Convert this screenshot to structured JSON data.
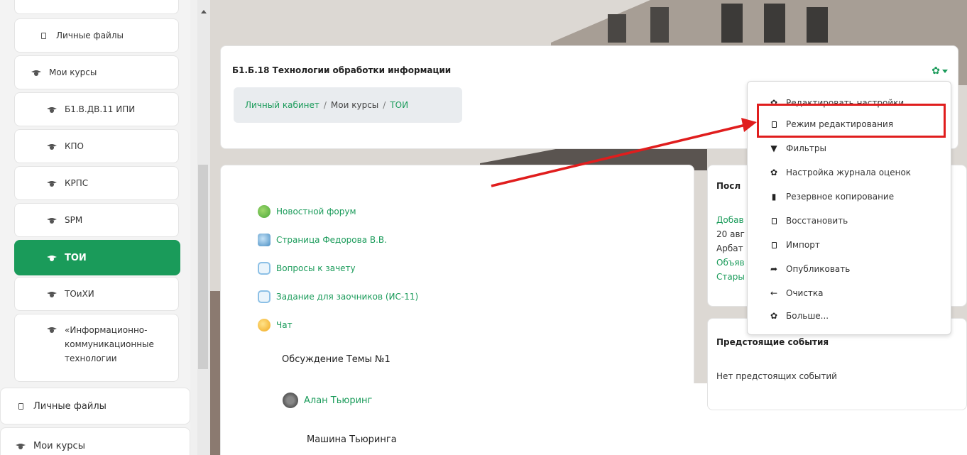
{
  "sidebar": {
    "items": [
      {
        "label": "Личные файлы",
        "icon": "file-icon"
      },
      {
        "label": "Мои курсы",
        "icon": "graduation-cap-icon"
      },
      {
        "label": "Б1.В.ДВ.11 ИПИ",
        "icon": "graduation-cap-icon"
      },
      {
        "label": "КПО",
        "icon": "graduation-cap-icon"
      },
      {
        "label": "КРПС",
        "icon": "graduation-cap-icon"
      },
      {
        "label": "SPM",
        "icon": "graduation-cap-icon"
      },
      {
        "label": "ТОИ",
        "icon": "graduation-cap-icon",
        "active": true
      },
      {
        "label": "ТОиХИ",
        "icon": "graduation-cap-icon"
      },
      {
        "label": "«Информационно-коммуникационные технологии",
        "icon": "graduation-cap-icon"
      },
      {
        "label": "Личные файлы",
        "icon": "file-icon"
      },
      {
        "label": "Мои курсы",
        "icon": "graduation-cap-icon"
      }
    ]
  },
  "header": {
    "course_title": "Б1.Б.18 Технологии обработки информации",
    "breadcrumb": [
      "Личный кабинет",
      "Мои курсы",
      "ТОИ"
    ],
    "gear": "gear-icon"
  },
  "activities": [
    {
      "label": "Новостной форум",
      "icon": "forum-icon"
    },
    {
      "label": "Страница Федорова В.В.",
      "icon": "page-icon"
    },
    {
      "label": "Вопросы к зачету",
      "icon": "quiz-icon"
    },
    {
      "label": "Задание для заочников (ИС-11)",
      "icon": "quiz-icon"
    },
    {
      "label": "Чат",
      "icon": "chat-icon"
    }
  ],
  "topic": {
    "discussion": "Обсуждение Темы №1",
    "person": "Алан Тьюринг",
    "machine": "Машина Тьюринга"
  },
  "right_blocks": {
    "latest_news_title_partial": "Посл",
    "latest_news_lines": [
      "Добав",
      "20 авг",
      "Арбат",
      "Объяв",
      "Стары"
    ],
    "upcoming_title": "Предстоящие события",
    "upcoming_empty": "Нет предстоящих событий"
  },
  "dropdown": {
    "items": [
      {
        "label": "Редактировать настройки",
        "icon": "gear-icon"
      },
      {
        "label": "Режим редактирования",
        "icon": "file-icon"
      },
      {
        "label": "Фильтры",
        "icon": "filter-icon"
      },
      {
        "label": "Настройка журнала оценок",
        "icon": "gear-icon"
      },
      {
        "label": "Резервное копирование",
        "icon": "backup-icon"
      },
      {
        "label": "Восстановить",
        "icon": "file-icon"
      },
      {
        "label": "Импорт",
        "icon": "file-icon"
      },
      {
        "label": "Опубликовать",
        "icon": "share-icon"
      },
      {
        "label": "Очистка",
        "icon": "arrow-left-icon"
      },
      {
        "label": "Больше...",
        "icon": "gear-icon"
      }
    ]
  },
  "colors": {
    "accent": "#1a9b5a",
    "highlight": "#e01d1d"
  }
}
